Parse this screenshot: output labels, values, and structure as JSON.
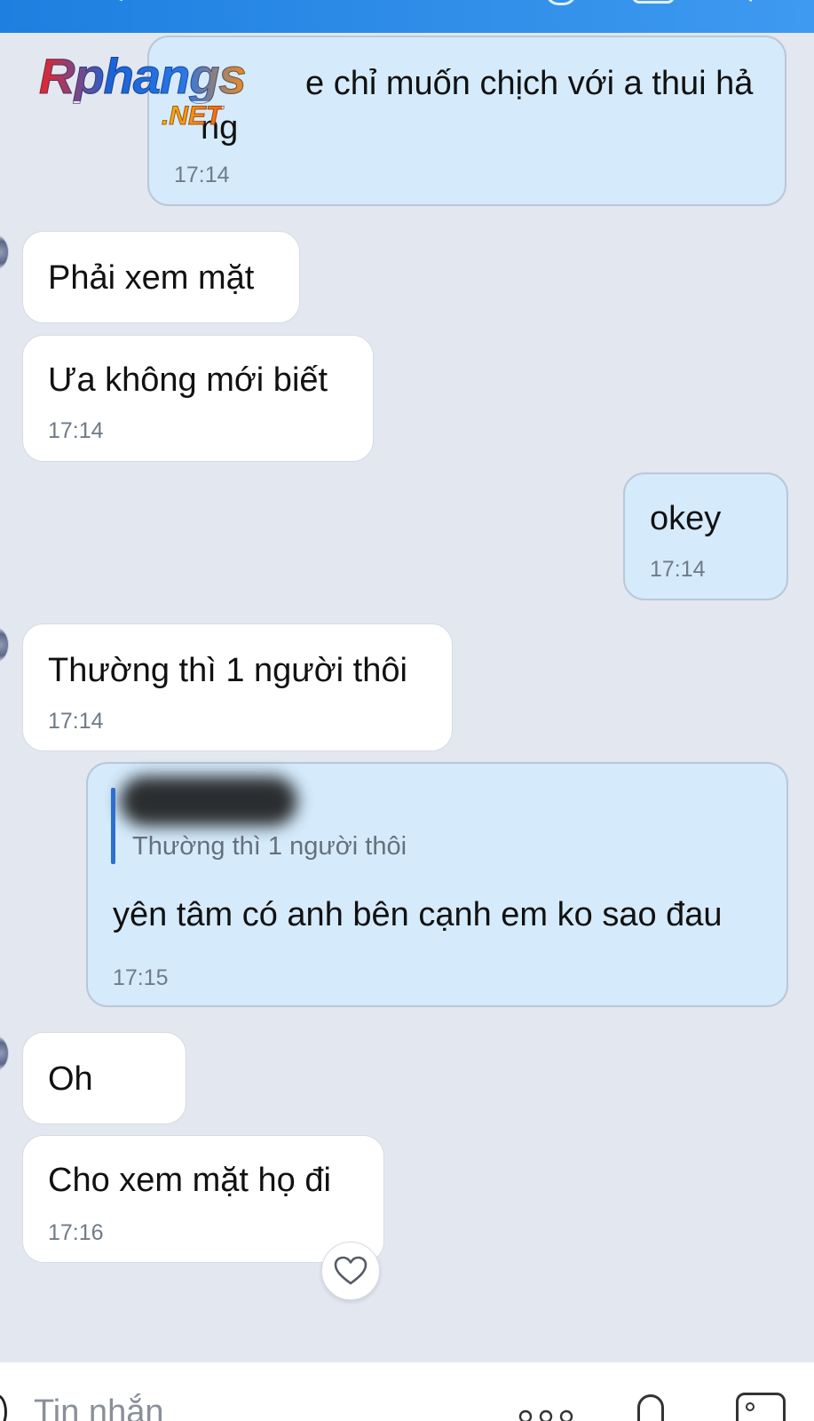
{
  "header": {
    "icons": [
      "call-icon",
      "video-icon",
      "menu-icon"
    ]
  },
  "watermark": {
    "line1": "Rphangs",
    "line2": ".NET"
  },
  "messages": [
    {
      "direction": "out",
      "text": "...thay a nè chỉ muốn chịch với a thui hả",
      "text_line2": "nàng",
      "time": "17:14"
    },
    {
      "direction": "in",
      "text": "Phải xem mặt",
      "time": ""
    },
    {
      "direction": "in",
      "text": "Ưa không mới biết",
      "time": "17:14"
    },
    {
      "direction": "out",
      "text": "okey",
      "time": "17:14"
    },
    {
      "direction": "in",
      "text": "Thường thì 1 người thôi",
      "time": "17:14"
    },
    {
      "direction": "out",
      "reply_quote": "Thường thì 1 người thôi",
      "text": "yên tâm có anh bên cạnh em ko sao đau",
      "time": "17:15"
    },
    {
      "direction": "in",
      "text": "Oh",
      "time": ""
    },
    {
      "direction": "in",
      "text": "Cho xem mặt họ đi",
      "time": "17:16"
    }
  ],
  "visible": {
    "m0_line1": "e chỉ muốn chịch với a thui hả",
    "m0_line2": "ng"
  },
  "reaction": {
    "icon": "heart-icon"
  },
  "input": {
    "placeholder": "Tin nhắn",
    "icons": [
      "more-icon",
      "microphone-icon",
      "image-icon"
    ]
  },
  "colors": {
    "header_blue": "#2b88e8",
    "background": "#e3e7ef",
    "outgoing_bubble": "#d5ebfc",
    "incoming_bubble": "#ffffff",
    "reply_bar": "#2c6fd0",
    "timestamp": "#6f7b88"
  }
}
